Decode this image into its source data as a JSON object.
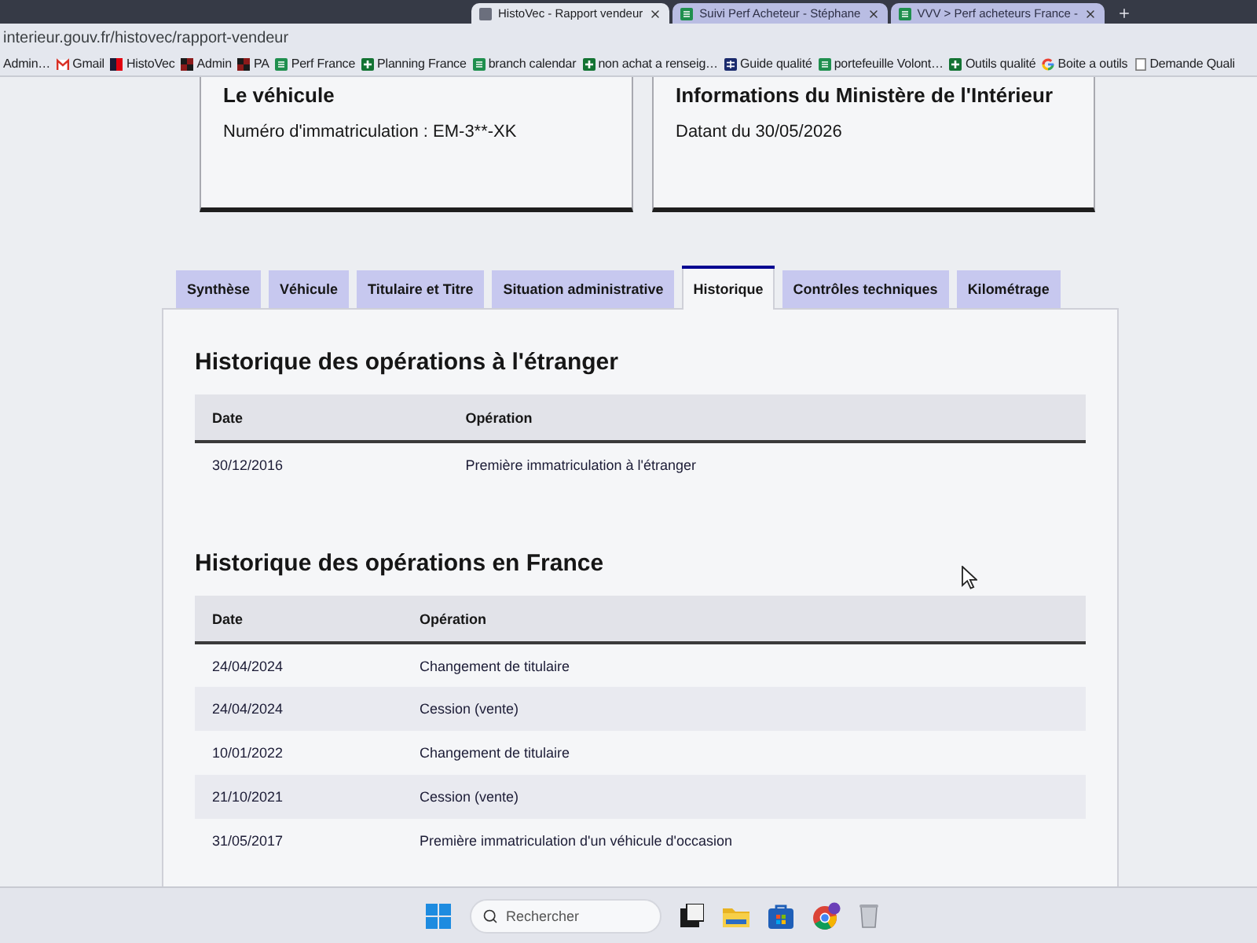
{
  "browser": {
    "tabs": [
      {
        "title": "HistoVec - Rapport vendeur",
        "kind": "page",
        "selected": true
      },
      {
        "title": "Suivi Perf Acheteur - Stéphane",
        "kind": "sheet",
        "selected": false
      },
      {
        "title": "VVV > Perf acheteurs France -",
        "kind": "sheet",
        "selected": false
      }
    ],
    "address": "interieur.gouv.fr/histovec/rapport-vendeur",
    "bookmarks": [
      {
        "label": "Admin…",
        "kind": "plain"
      },
      {
        "label": "Gmail",
        "kind": "mail"
      },
      {
        "label": "HistoVec",
        "kind": "flag"
      },
      {
        "label": "Admin",
        "kind": "tile"
      },
      {
        "label": "PA",
        "kind": "tile"
      },
      {
        "label": "Perf France",
        "kind": "sheet"
      },
      {
        "label": "Planning France",
        "kind": "plus"
      },
      {
        "label": "branch calendar",
        "kind": "sheet"
      },
      {
        "label": "non achat a renseig…",
        "kind": "plus"
      },
      {
        "label": "Guide qualité",
        "kind": "grid"
      },
      {
        "label": "portefeuille Volont…",
        "kind": "sheet"
      },
      {
        "label": "Outils qualité",
        "kind": "plus"
      },
      {
        "label": "Boite a outils",
        "kind": "ring"
      },
      {
        "label": "Demande Quali",
        "kind": "doc"
      }
    ]
  },
  "cards": [
    {
      "title": "Le véhicule",
      "text": "Numéro d'immatriculation : EM-3**-XK"
    },
    {
      "title": "Informations du Ministère de l'Intérieur",
      "text": "Datant du 30/05/2026"
    }
  ],
  "tabs": [
    {
      "label": "Synthèse",
      "selected": false
    },
    {
      "label": "Véhicule",
      "selected": false
    },
    {
      "label": "Titulaire et Titre",
      "selected": false
    },
    {
      "label": "Situation administrative",
      "selected": false
    },
    {
      "label": "Historique",
      "selected": true
    },
    {
      "label": "Contrôles techniques",
      "selected": false
    },
    {
      "label": "Kilométrage",
      "selected": false
    }
  ],
  "sections": [
    {
      "title": "Historique des opérations à l'étranger",
      "columns": [
        "Date",
        "Opération"
      ],
      "rows": [
        {
          "date": "30/12/2016",
          "operation": "Première immatriculation à l'étranger"
        }
      ]
    },
    {
      "title": "Historique des opérations en France",
      "columns": [
        "Date",
        "Opération"
      ],
      "rows": [
        {
          "date": "24/04/2024",
          "operation": "Changement de titulaire"
        },
        {
          "date": "24/04/2024",
          "operation": "Cession (vente)"
        },
        {
          "date": "10/01/2022",
          "operation": "Changement de titulaire"
        },
        {
          "date": "21/10/2021",
          "operation": "Cession (vente)"
        },
        {
          "date": "31/05/2017",
          "operation": "Première immatriculation d'un véhicule d'occasion"
        }
      ]
    }
  ],
  "taskbar": {
    "search": {
      "placeholder": "Rechercher"
    }
  }
}
